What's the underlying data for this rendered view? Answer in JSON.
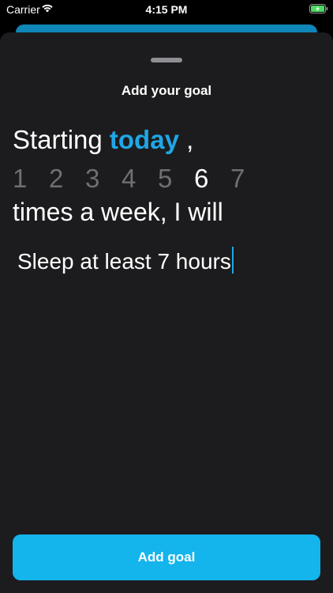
{
  "status_bar": {
    "carrier": "Carrier",
    "time": "4:15 PM",
    "wifi_icon": "wifi-icon",
    "battery_icon": "battery-charging-icon"
  },
  "sheet": {
    "title": "Add your goal",
    "starting_prefix": "Starting",
    "starting_highlight": "today",
    "starting_suffix": " ,",
    "days": [
      "1",
      "2",
      "3",
      "4",
      "5",
      "6",
      "7"
    ],
    "selected_day": "6",
    "times_text": "times a week, I will",
    "goal_value": "Sleep at least 7 hours",
    "add_button_label": "Add goal"
  },
  "colors": {
    "accent": "#14b4ec",
    "highlight": "#1fa7e6",
    "sheet_background": "#1c1c1e",
    "inactive_day": "#6e6e73"
  }
}
